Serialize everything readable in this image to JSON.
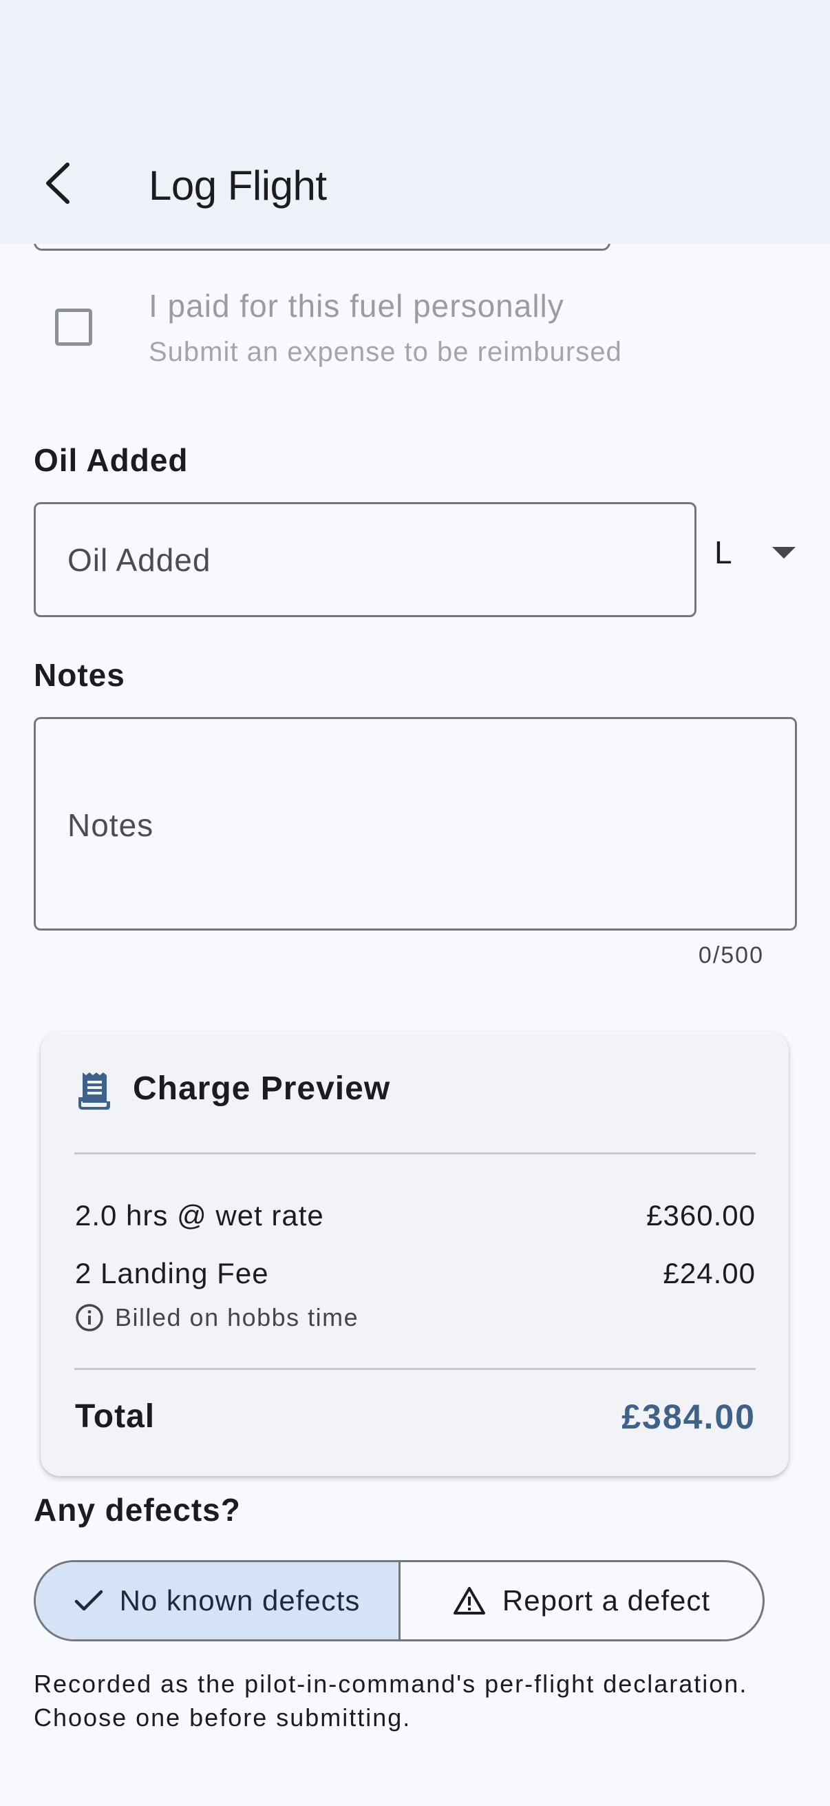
{
  "app_bar": {
    "title": "Log Flight"
  },
  "fuel_personal": {
    "label": "I paid for this fuel personally",
    "sublabel": "Submit an expense to be reimbursed",
    "checked": false
  },
  "oil": {
    "section_label": "Oil Added",
    "placeholder": "Oil Added",
    "unit": "L"
  },
  "notes": {
    "section_label": "Notes",
    "placeholder": "Notes",
    "counter": "0/500"
  },
  "charge_preview": {
    "title": "Charge Preview",
    "icon": "receipt-icon",
    "lines": [
      {
        "label": "2.0 hrs @ wet rate",
        "amount": "£360.00"
      },
      {
        "label": "2 Landing Fee",
        "amount": "£24.00"
      }
    ],
    "info_text": "Billed on hobbs time",
    "total_label": "Total",
    "total_amount": "£384.00"
  },
  "defects": {
    "section_label": "Any defects?",
    "options": [
      {
        "label": "No known defects",
        "icon": "check-icon",
        "selected": true
      },
      {
        "label": "Report a defect",
        "icon": "warning-icon",
        "selected": false
      }
    ],
    "declaration": "Recorded as the pilot-in-command's per-flight declaration. Choose one before submitting."
  },
  "colors": {
    "app_bar_bg": "#EEF1F8",
    "page_bg": "#F7F9FE",
    "card_bg": "#F2F3F7",
    "accent": "#3E6289",
    "selected_segment_bg": "#D6E3F6",
    "outline": "#74777F"
  }
}
